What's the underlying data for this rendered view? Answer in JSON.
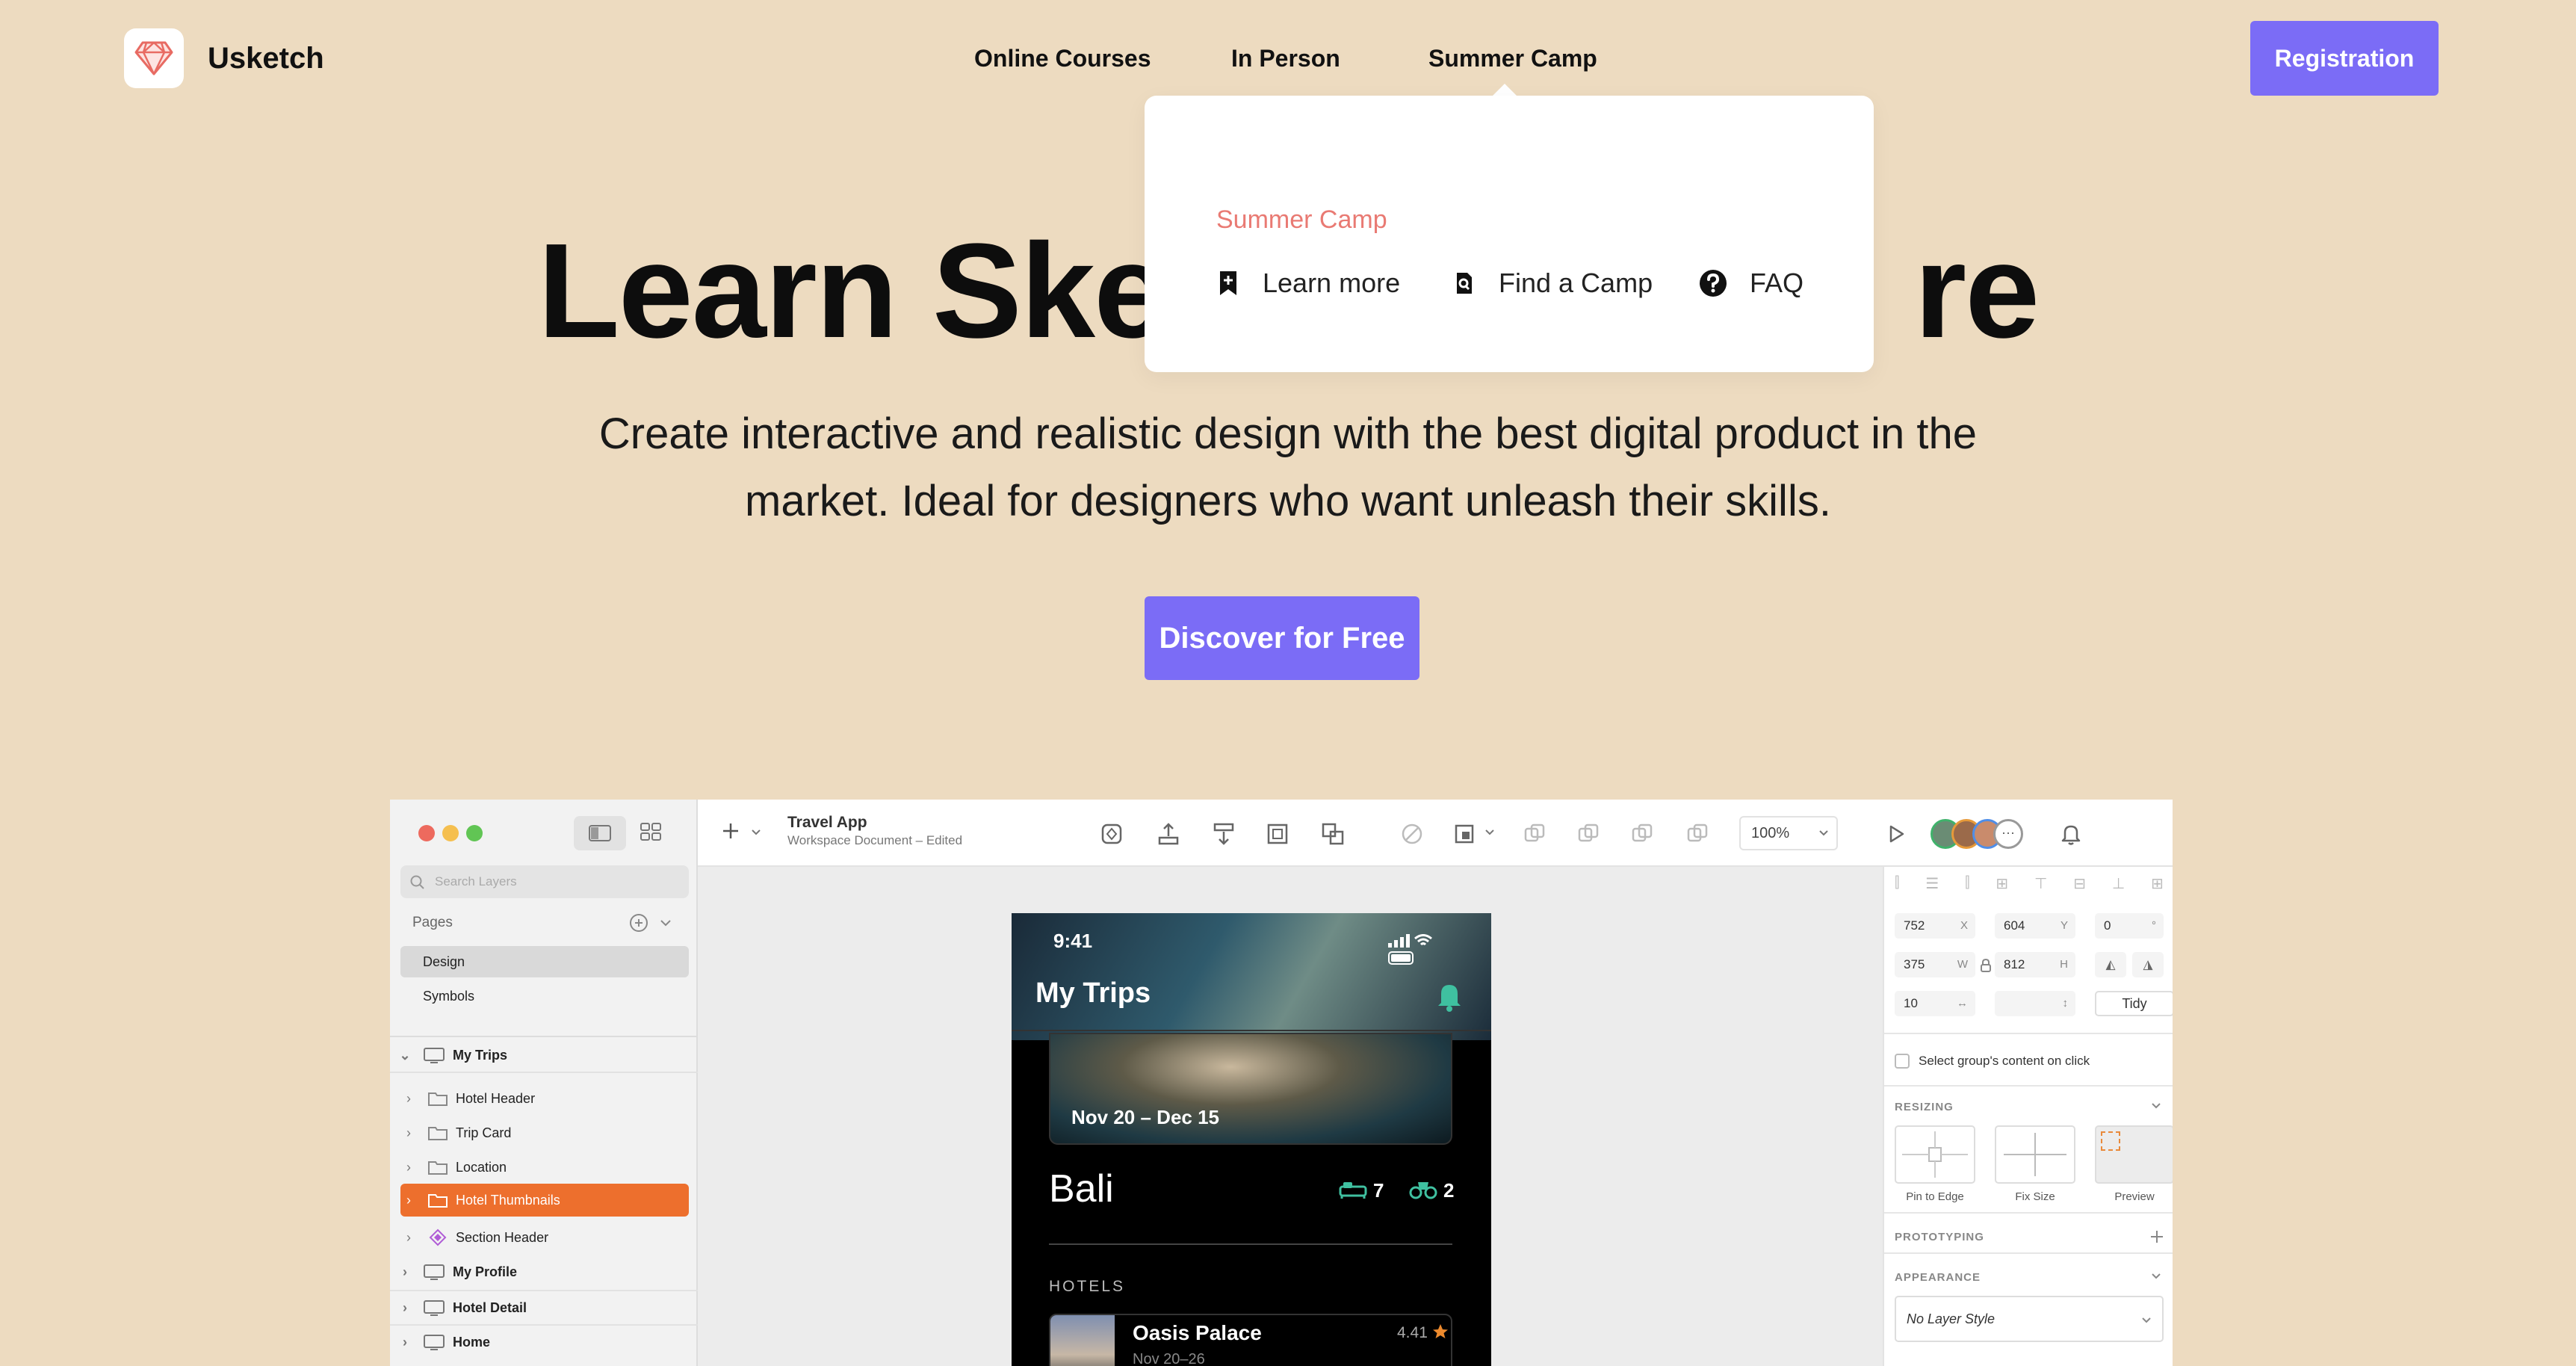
{
  "header": {
    "brand": "Usketch",
    "nav": [
      "Online Courses",
      "In Person",
      "Summer Camp"
    ],
    "registration": "Registration"
  },
  "dropdown": {
    "title": "Summer Camp",
    "items": [
      {
        "label": "Learn more",
        "icon": "bookmark-plus-icon"
      },
      {
        "label": "Find a Camp",
        "icon": "search-doc-icon"
      },
      {
        "label": "FAQ",
        "icon": "help-circle-icon"
      }
    ]
  },
  "hero": {
    "title_left": "Learn Ske",
    "title_right": "re",
    "subtitle_line1": "Create interactive and realistic design with the best digital product in the",
    "subtitle_line2": "market. Ideal for designers who want unleash their skills.",
    "cta": "Discover for Free"
  },
  "app": {
    "doc_title": "Travel App",
    "doc_subtitle": "Workspace Document – Edited",
    "zoom": "100%",
    "search_placeholder": "Search Layers",
    "pages_label": "Pages",
    "pages": [
      "Design",
      "Symbols"
    ],
    "layers": [
      {
        "label": "My Trips",
        "bold": true
      },
      {
        "label": "Hotel Header"
      },
      {
        "label": "Trip Card"
      },
      {
        "label": "Location"
      },
      {
        "label": "Hotel Thumbnails",
        "selected": true
      },
      {
        "label": "Section Header"
      },
      {
        "label": "My Profile",
        "bold": true
      },
      {
        "label": "Hotel Detail",
        "bold": true
      },
      {
        "label": "Home",
        "bold": true
      }
    ],
    "inspector": {
      "x": "752",
      "x_lbl": "X",
      "y": "604",
      "y_lbl": "Y",
      "rot": "0",
      "rot_lbl": "°",
      "w": "375",
      "w_lbl": "W",
      "h": "812",
      "h_lbl": "H",
      "spacing": "10",
      "tidy": "Tidy",
      "select_group": "Select group's content on click",
      "resizing": "RESIZING",
      "pin": "Pin to Edge",
      "fix": "Fix Size",
      "preview": "Preview",
      "prototyping": "PROTOTYPING",
      "appearance": "APPEARANCE",
      "layer_style": "No Layer Style"
    },
    "phone": {
      "time": "9:41",
      "title": "My Trips",
      "dates": "Nov 20 – Dec 15",
      "place": "Bali",
      "beds": "7",
      "binos": "2",
      "section": "HOTELS",
      "hotel_name": "Oasis Palace",
      "hotel_rating": "4.41",
      "hotel_dates": "Nov 20–26"
    }
  },
  "colors": {
    "background": "#eddbc0",
    "accent": "#7b6cf6",
    "dropdown_title": "#e97a73",
    "layer_selected": "#ed6f2d"
  }
}
